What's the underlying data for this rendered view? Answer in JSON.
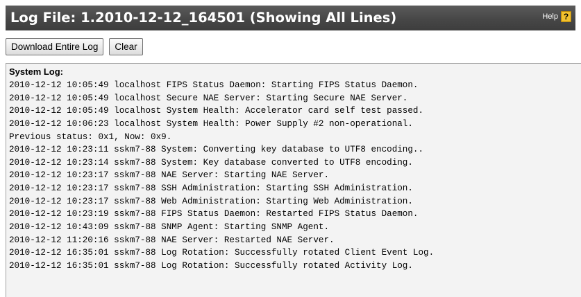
{
  "header": {
    "title": "Log File: 1.2010-12-12_164501 (Showing All Lines)",
    "help_label": "Help",
    "help_icon_glyph": "?",
    "help_icon": "help-icon"
  },
  "toolbar": {
    "download_label": "Download Entire Log",
    "clear_label": "Clear"
  },
  "log": {
    "heading": "System Log:",
    "lines": [
      "2010-12-12 10:05:49 localhost FIPS Status Daemon: Starting FIPS Status Daemon.",
      "2010-12-12 10:05:49 localhost Secure NAE Server: Starting Secure NAE Server.",
      "2010-12-12 10:05:49 localhost System Health: Accelerator card self test passed.",
      "2010-12-12 10:06:23 localhost System Health: Power Supply #2 non-operational.",
      "Previous status: 0x1, Now: 0x9.",
      "2010-12-12 10:23:11 sskm7-88 System: Converting key database to UTF8 encoding..",
      "2010-12-12 10:23:14 sskm7-88 System: Key database converted to UTF8 encoding.",
      "2010-12-12 10:23:17 sskm7-88 NAE Server: Starting NAE Server.",
      "2010-12-12 10:23:17 sskm7-88 SSH Administration: Starting SSH Administration.",
      "2010-12-12 10:23:17 sskm7-88 Web Administration: Starting Web Administration.",
      "2010-12-12 10:23:19 sskm7-88 FIPS Status Daemon: Restarted FIPS Status Daemon.",
      "2010-12-12 10:43:09 sskm7-88 SNMP Agent: Starting SNMP Agent.",
      "2010-12-12 11:20:16 sskm7-88 NAE Server: Restarted NAE Server.",
      "2010-12-12 16:35:01 sskm7-88 Log Rotation: Successfully rotated Client Event Log.",
      "2010-12-12 16:35:01 sskm7-88 Log Rotation: Successfully rotated Activity Log."
    ]
  },
  "colors": {
    "title_bar": "#474747",
    "title_text": "#ffffff",
    "help_icon_bg": "#f2c12e",
    "log_panel_bg": "#f3f3f3"
  }
}
